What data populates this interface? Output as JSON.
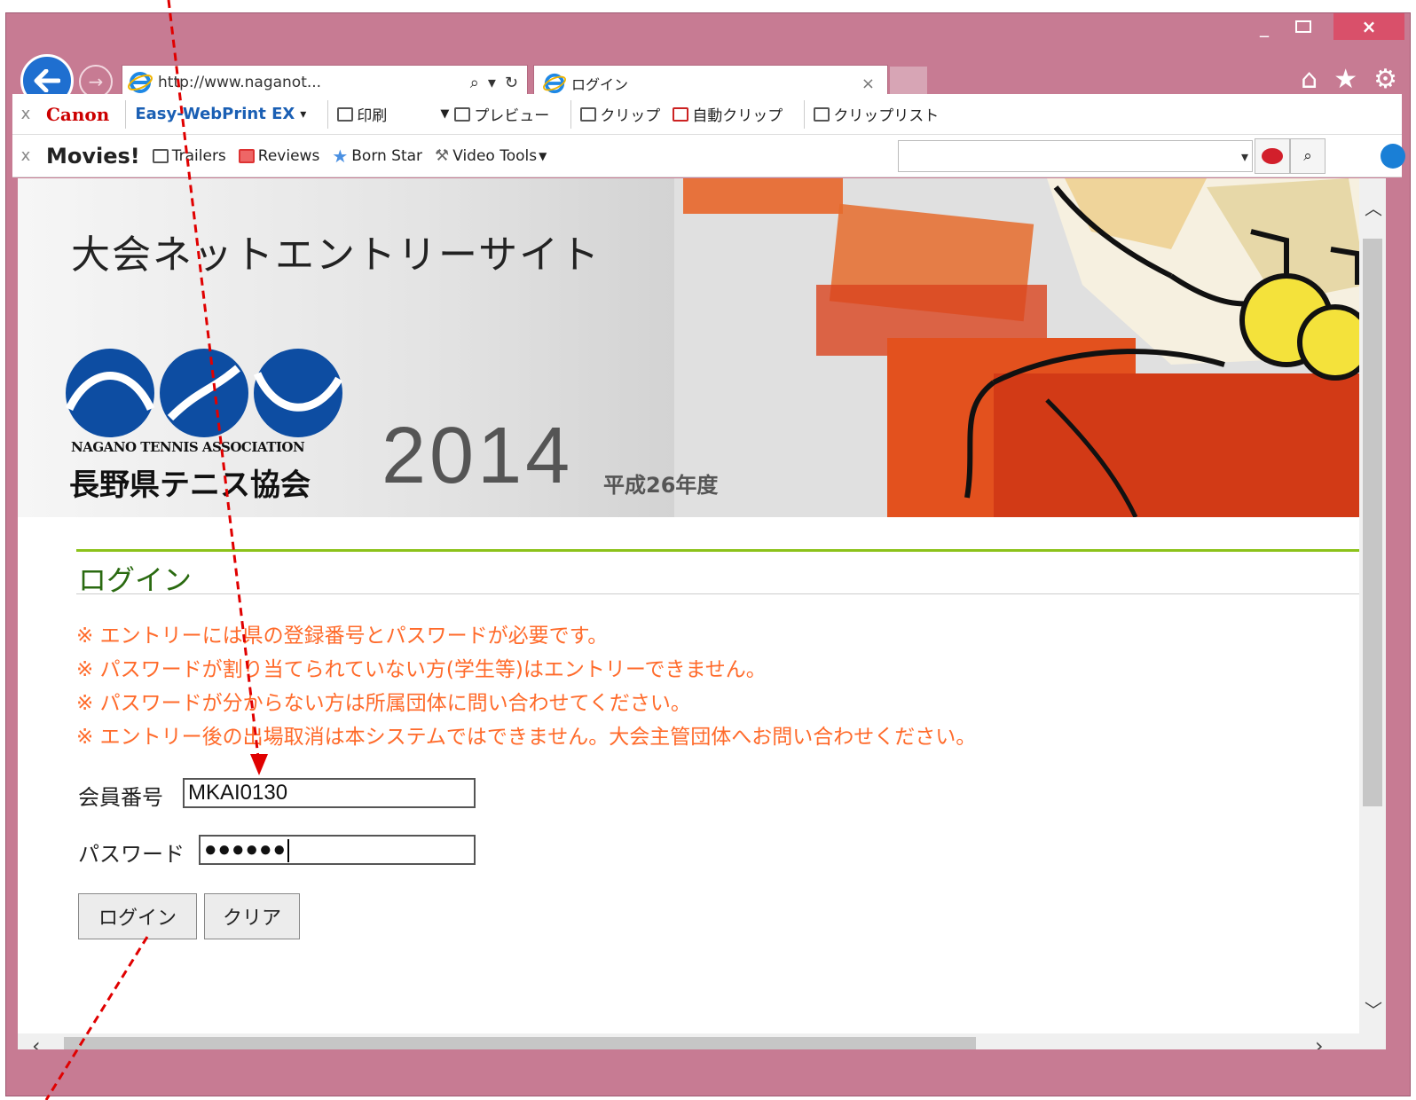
{
  "window": {
    "min_glyph": "_",
    "close_glyph": "×"
  },
  "address_bar": {
    "url": "http://www.naganot...",
    "search_glyph": "⌕",
    "dropdown_glyph": "▾",
    "refresh_glyph": "↻"
  },
  "tab": {
    "title": "ログイン",
    "close_glyph": "×"
  },
  "toolbar_right": {
    "home": "⌂",
    "favorites": "★",
    "settings": "⚙"
  },
  "toolbar1": {
    "brand": "Canon",
    "app": "Easy-WebPrint EX",
    "app_dropdown": "▾",
    "items": [
      "印刷",
      "プレビュー",
      "クリップ",
      "自動クリップ",
      "クリップリスト"
    ]
  },
  "toolbar2": {
    "brand": "Movies!",
    "items": [
      "Trailers",
      "Reviews",
      "Born Star",
      "Video Tools"
    ]
  },
  "banner": {
    "site_title": "大会ネットエントリーサイト",
    "assoc_en": "NAGANO TENNIS ASSOCIATION",
    "assoc_ja": "長野県テニス協会",
    "year": "2014",
    "year_sub": "平成26年度"
  },
  "login": {
    "heading": "ログイン",
    "notices": [
      "※ エントリーには県の登録番号とパスワードが必要です。",
      "※ パスワードが割り当てられていない方(学生等)はエントリーできません。",
      "※ パスワードが分からない方は所属団体に問い合わせてください。",
      "※ エントリー後の出場取消は本システムではできません。大会主管団体へお問い合わせください。"
    ],
    "member_label": "会員番号",
    "member_value": "MKAI0130",
    "password_label": "パスワード",
    "password_value": "●●●●●●",
    "login_button": "ログイン",
    "clear_button": "クリア"
  },
  "icons": {
    "back": "back-arrow-icon",
    "forward": "forward-arrow-icon",
    "ie": "ie-logo-icon"
  },
  "colors": {
    "frame": "#c77b93",
    "notice": "#ff6a2a",
    "heading": "#2a6a10",
    "rule": "#8cc21a",
    "annotation": "#e00000"
  }
}
